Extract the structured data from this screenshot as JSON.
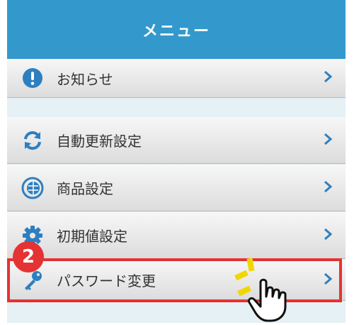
{
  "header": {
    "title": "メニュー"
  },
  "menu": {
    "items": [
      {
        "label": "お知らせ",
        "icon": "info-icon"
      },
      {
        "label": "自動更新設定",
        "icon": "refresh-icon"
      },
      {
        "label": "商品設定",
        "icon": "globe-icon"
      },
      {
        "label": "初期値設定",
        "icon": "gear-icon"
      },
      {
        "label": "パスワード変更",
        "icon": "key-icon"
      }
    ]
  },
  "annotation": {
    "step_number": "2"
  },
  "colors": {
    "header": "#3399cc",
    "accent_icon": "#2e7fc0",
    "highlight": "#e53333",
    "background": "#e6f1f6"
  }
}
